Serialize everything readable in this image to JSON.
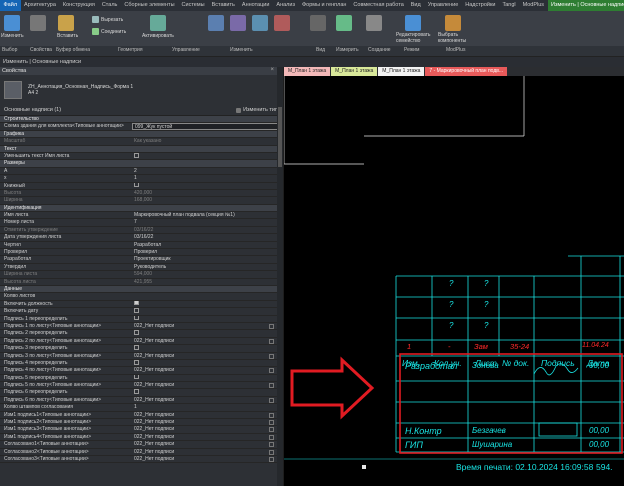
{
  "menu": [
    "Файл",
    "Архитектура",
    "Конструкция",
    "Сталь",
    "Сборные элементы",
    "Системы",
    "Вставить",
    "Аннотации",
    "Анализ",
    "Формы и генплан",
    "Совместная работа",
    "Вид",
    "Управление",
    "Надстройки",
    "Tangl",
    "ModPlus",
    "Изменить | Основные надписи"
  ],
  "ribbon": {
    "modify": "Изменить",
    "paste": "Вставить",
    "cut": "Вырезать",
    "join": "Соединить",
    "activate": "Активировать",
    "edit_family": "Редактировать семейство",
    "pick_components": "Выбрать компоненты"
  },
  "ribbon_groups": [
    "Выбор",
    "Свойства",
    "Буфер обмена",
    "Геометрия",
    "Управление",
    "Изменить",
    "Вид",
    "Измерить",
    "Создание",
    "Режим",
    "ModPlus"
  ],
  "context_bar": "Изменить | Основные надписи",
  "properties": {
    "title": "Свойства",
    "type_name": "ZH_Аннотация_Основная_Надпись_Форма 1",
    "type_size": "А4 2",
    "selection": "Основные надписи (1)",
    "edit_type": "Изменить тип",
    "rows": [
      {
        "k": "Строительство",
        "v": "",
        "t": "grp"
      },
      {
        "k": "Схема здания для комплекта<Типовые аннотации>",
        "v": "099_Жук пустой",
        "t": "input"
      },
      {
        "k": "Графика",
        "v": "",
        "t": "grp"
      },
      {
        "k": "Масштаб",
        "v": "Как указано",
        "t": "dim"
      },
      {
        "k": "Текст",
        "v": "",
        "t": "grp"
      },
      {
        "k": "Уменьшить текст Имя листа",
        "v": "",
        "t": "cb"
      },
      {
        "k": "Размеры",
        "v": "",
        "t": "grp"
      },
      {
        "k": "А",
        "v": "2",
        "t": ""
      },
      {
        "k": "х",
        "v": "1",
        "t": ""
      },
      {
        "k": "Книжный",
        "v": "",
        "t": "cb"
      },
      {
        "k": "Высота",
        "v": "420,000",
        "t": "dim"
      },
      {
        "k": "Ширина",
        "v": "168,000",
        "t": "dim"
      },
      {
        "k": "Идентификация",
        "v": "",
        "t": "grp"
      },
      {
        "k": "Имя листа",
        "v": "Маркировочный план подвала (секция №1)",
        "t": ""
      },
      {
        "k": "Номер листа",
        "v": "7",
        "t": ""
      },
      {
        "k": "Отметить утверждение",
        "v": "03/16/22",
        "t": "dim"
      },
      {
        "k": "Дата утверждения листа",
        "v": "03/16/22",
        "t": ""
      },
      {
        "k": "Чертил",
        "v": "Разработал",
        "t": ""
      },
      {
        "k": "Проверил",
        "v": "Проверил",
        "t": ""
      },
      {
        "k": "Разработал",
        "v": "Проектировщик",
        "t": ""
      },
      {
        "k": "Утвердил",
        "v": "Руководитель",
        "t": ""
      },
      {
        "k": "Ширина листа",
        "v": "594,000",
        "t": "dim"
      },
      {
        "k": "Высота листа",
        "v": "421,955",
        "t": "dim"
      },
      {
        "k": "Данные",
        "v": "",
        "t": "grp"
      },
      {
        "k": "Колво листов",
        "v": "",
        "t": ""
      },
      {
        "k": "Включить должность",
        "v": "",
        "t": "cbon"
      },
      {
        "k": "Включить дату",
        "v": "",
        "t": "cb"
      },
      {
        "k": "Подпись 1 переопределить",
        "v": "",
        "t": "cb"
      },
      {
        "k": "Подпись 1 по листу<Типовые аннотации>",
        "v": "022_Нет подписи",
        "t": "btn"
      },
      {
        "k": "Подпись 2 переопределить",
        "v": "",
        "t": "cb"
      },
      {
        "k": "Подпись 2 по листу<Типовые аннотации>",
        "v": "022_Нет подписи",
        "t": "btn"
      },
      {
        "k": "Подпись 3 переопределить",
        "v": "",
        "t": "cb"
      },
      {
        "k": "Подпись 3 по листу<Типовые аннотации>",
        "v": "022_Нет подписи",
        "t": "btn"
      },
      {
        "k": "Подпись 4 переопределить",
        "v": "",
        "t": "cb"
      },
      {
        "k": "Подпись 4 по листу<Типовые аннотации>",
        "v": "022_Нет подписи",
        "t": "btn"
      },
      {
        "k": "Подпись 5 переопределить",
        "v": "",
        "t": "cb"
      },
      {
        "k": "Подпись 5 по листу<Типовые аннотации>",
        "v": "022_Нет подписи",
        "t": "btn"
      },
      {
        "k": "Подпись 6 переопределить",
        "v": "",
        "t": "cb"
      },
      {
        "k": "Подпись 6 по листу<Типовые аннотации>",
        "v": "022_Нет подписи",
        "t": "btn"
      },
      {
        "k": "Колво штампов согласования",
        "v": "1",
        "t": ""
      },
      {
        "k": "Изм1 подпись1<Типовые аннотации>",
        "v": "022_Нет подписи",
        "t": "btn"
      },
      {
        "k": "Изм1 подпись2<Типовые аннотации>",
        "v": "022_Нет подписи",
        "t": "btn"
      },
      {
        "k": "Изм1 подпись3<Типовые аннотации>",
        "v": "022_Нет подписи",
        "t": "btn"
      },
      {
        "k": "Изм1 подпись4<Типовые аннотации>",
        "v": "022_Нет подписи",
        "t": "btn"
      },
      {
        "k": "Согласовано1<Типовые аннотации>",
        "v": "022_Нет подписи",
        "t": "btn"
      },
      {
        "k": "Согласовано2<Типовые аннотации>",
        "v": "022_Нет подписи",
        "t": "btn"
      },
      {
        "k": "Согласовано3<Типовые аннотации>",
        "v": "022_Нет подписи",
        "t": "btn"
      }
    ]
  },
  "tabs": [
    "М_План 1 этажа",
    "М_План 1 этажа",
    "М_План 1 этажа",
    "7 - Маркировочный план подв..."
  ],
  "title_block": {
    "q": "?",
    "red_row": [
      "1",
      "-",
      "Зам",
      "35-24",
      "11.04.24"
    ],
    "headers": [
      "Изм.",
      "Кол.уч.",
      "Лист",
      "№ док.",
      "Подпись",
      "Дата"
    ],
    "rows": [
      {
        "role": "Разработал",
        "name": "Зонова",
        "date": "00,00"
      },
      {
        "role": "Н.Контр",
        "name": "Безгачев",
        "date": "00,00"
      },
      {
        "role": "ГИП",
        "name": "Шушарина",
        "date": "00,00"
      }
    ],
    "print_time": "Время печати: 02.10.2024  16:09:58",
    "sheet_width": "594."
  },
  "colors": {
    "cyan": "#19e3e3",
    "red": "#ff2a2a",
    "green": "#2fe62f",
    "highlight": "#e11b22"
  }
}
